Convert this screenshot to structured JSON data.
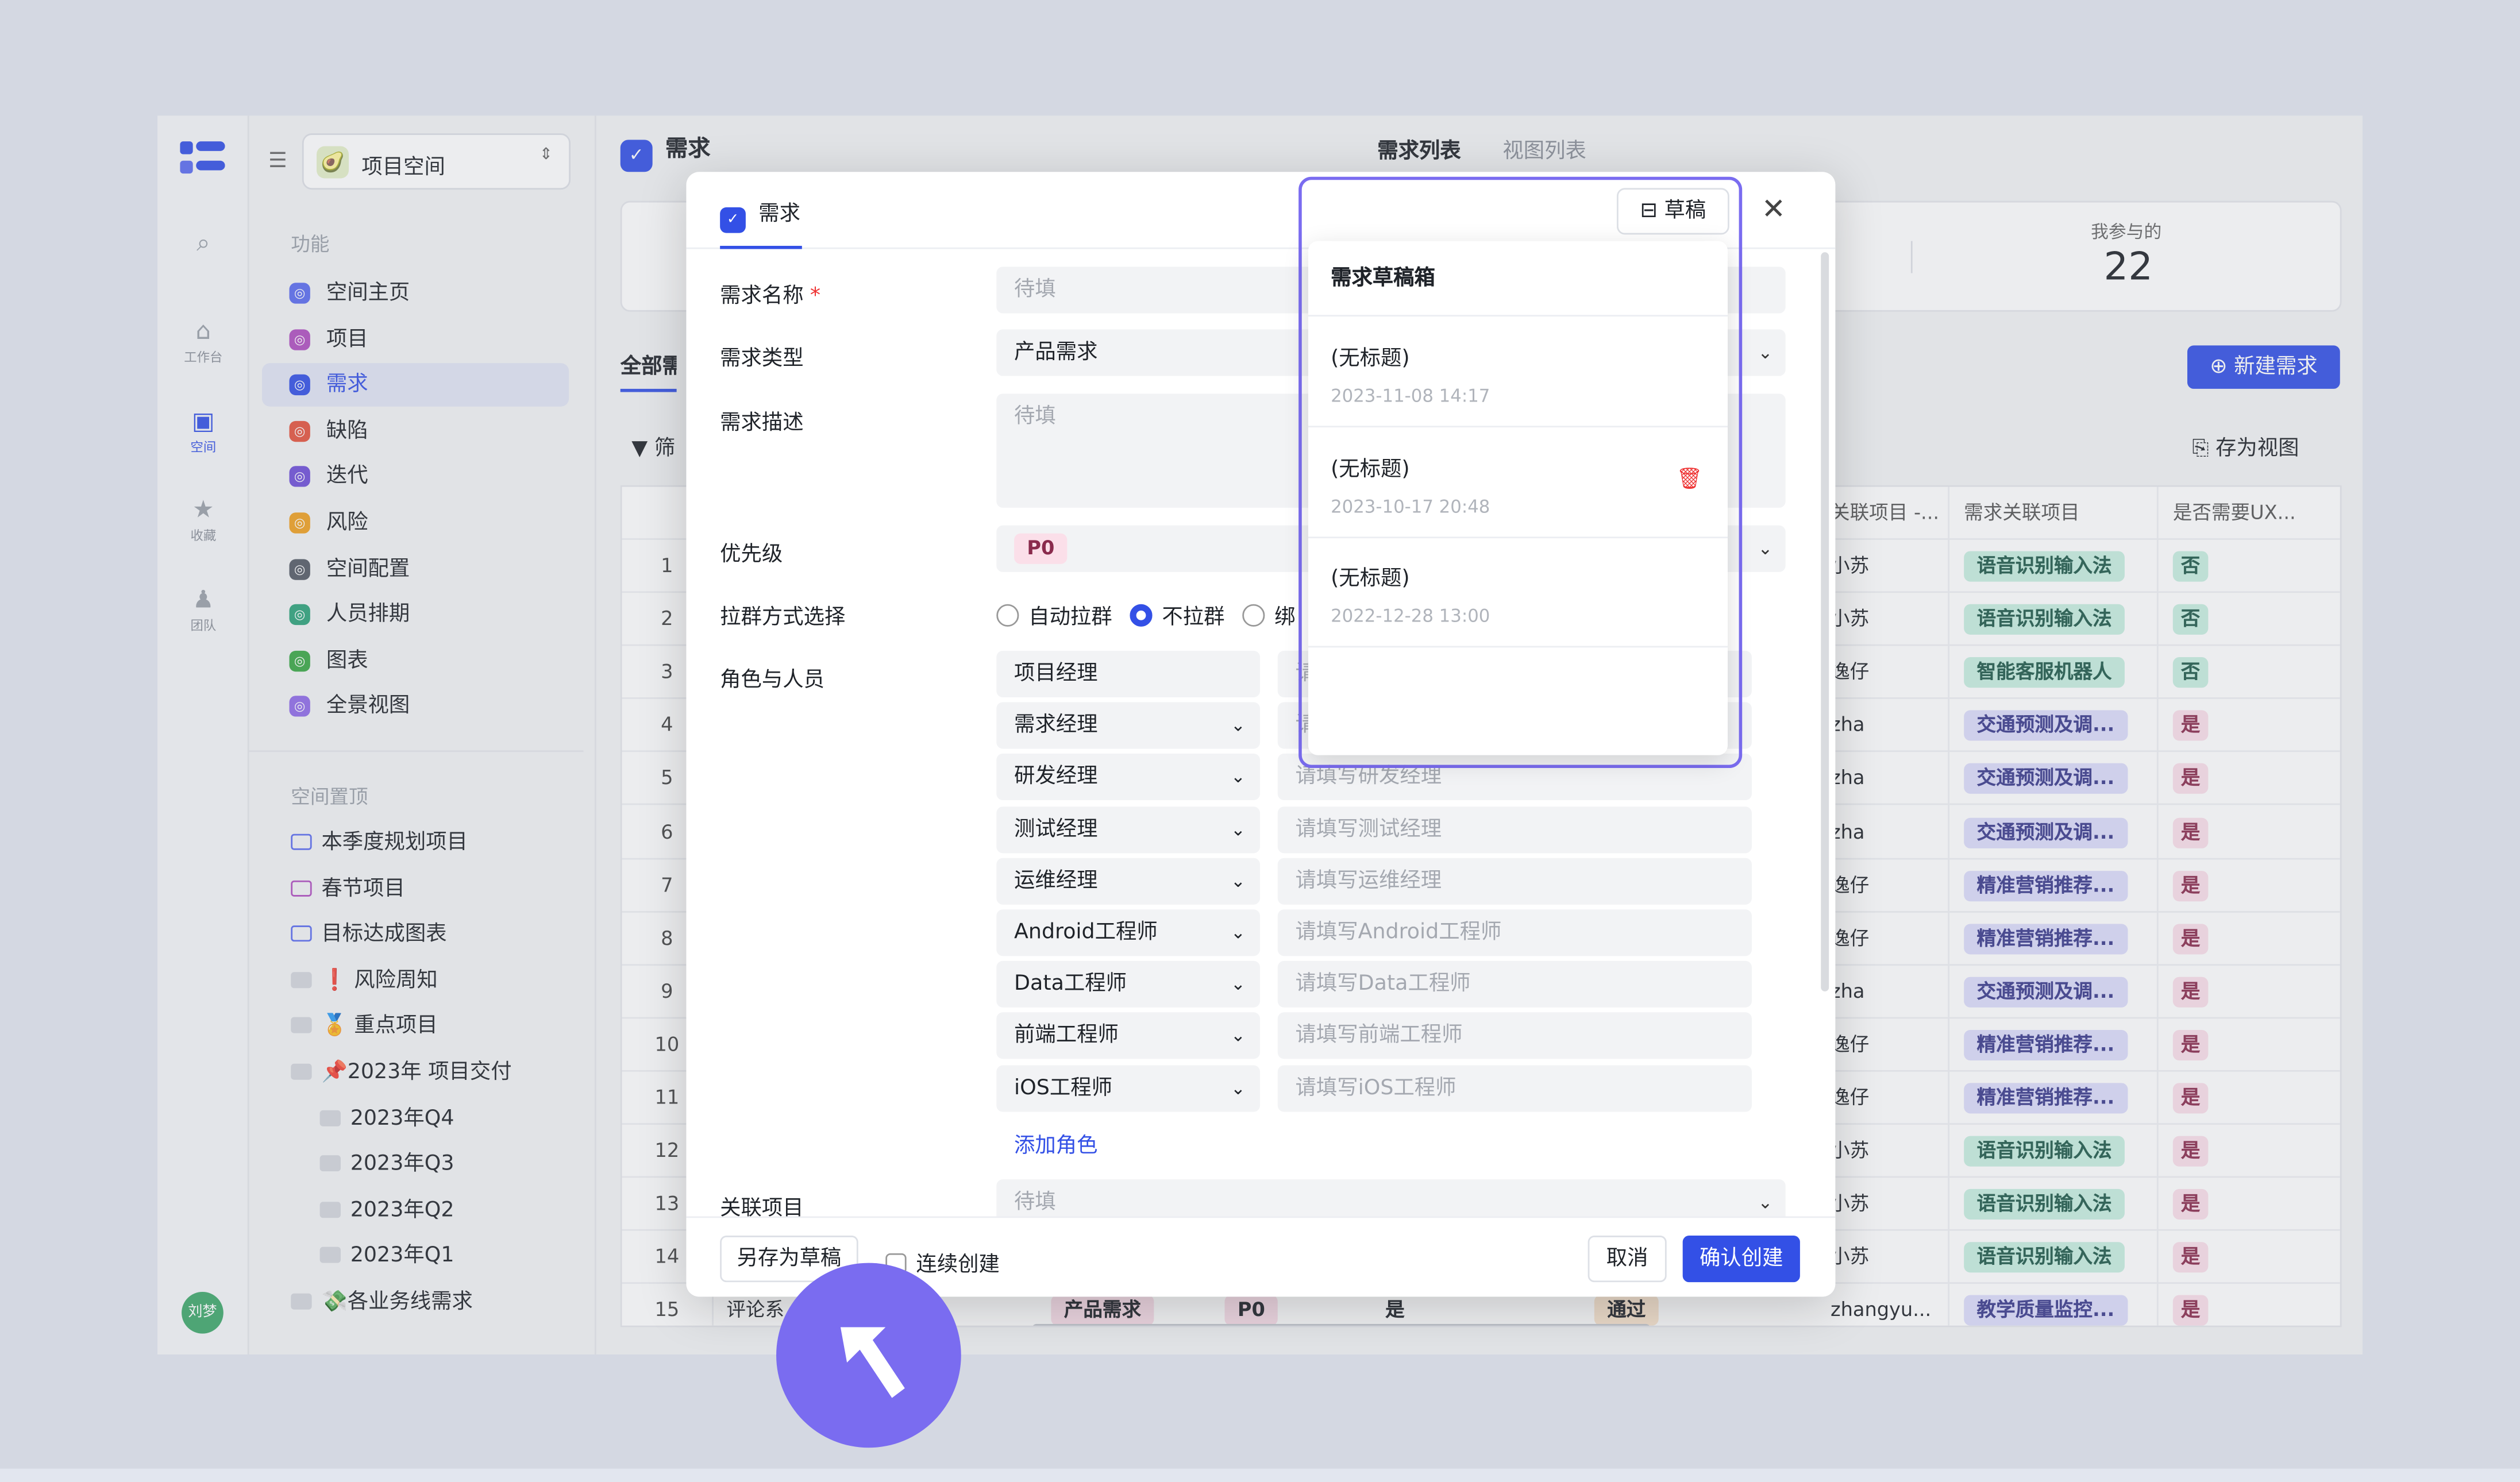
{
  "rail": {
    "items": [
      {
        "label": "工作台"
      },
      {
        "label": "空间"
      },
      {
        "label": "收藏"
      },
      {
        "label": "团队"
      }
    ],
    "avatar": "刘梦"
  },
  "sidebar": {
    "space": "项目空间",
    "section1": "功能",
    "items": [
      {
        "label": "空间主页",
        "color": "#5b6cf0"
      },
      {
        "label": "项目",
        "color": "#b04fc0"
      },
      {
        "label": "需求",
        "color": "#3350e6"
      },
      {
        "label": "缺陷",
        "color": "#e5533d"
      },
      {
        "label": "迭代",
        "color": "#6e4fd8"
      },
      {
        "label": "风险",
        "color": "#f0a020"
      },
      {
        "label": "空间配置",
        "color": "#555b66"
      },
      {
        "label": "人员排期",
        "color": "#2ea37a"
      },
      {
        "label": "图表",
        "color": "#3aa845"
      },
      {
        "label": "全景视图",
        "color": "#8f6be8"
      }
    ],
    "section2": "空间置顶",
    "pinned": [
      {
        "label": "本季度规划项目"
      },
      {
        "label": "春节项目"
      },
      {
        "label": "目标达成图表"
      },
      {
        "label": "❗ 风险周知"
      },
      {
        "label": "🏅 重点项目"
      },
      {
        "label": "📌2023年 项目交付"
      },
      {
        "label": "2023年Q4"
      },
      {
        "label": "2023年Q3"
      },
      {
        "label": "2023年Q2"
      },
      {
        "label": "2023年Q1"
      },
      {
        "label": "💸各业务线需求"
      }
    ]
  },
  "main": {
    "title": "需求",
    "tabs": [
      "需求列表",
      "视图列表"
    ],
    "stat_label": "我参与的",
    "stat_value": "22",
    "all_tab": "全部需求",
    "filter": "筛",
    "new_btn": "新建需求",
    "save_view": "存为视图",
    "columns": [
      "关联项目 -...",
      "需求关联项目",
      "是否需要UX..."
    ],
    "rows": [
      {
        "n": "1",
        "p": "小苏",
        "tag": "语音识别输入法",
        "tc": "a",
        "ux": "否"
      },
      {
        "n": "2",
        "p": "小苏",
        "tag": "语音识别输入法",
        "tc": "a",
        "ux": "否"
      },
      {
        "n": "3",
        "p": "逸仔",
        "tag": "智能客服机器人",
        "tc": "a",
        "ux": "否"
      },
      {
        "n": "4",
        "p": "zha",
        "tag": "交通预测及调...",
        "tc": "b",
        "ux": "是"
      },
      {
        "n": "5",
        "p": "zha",
        "tag": "交通预测及调...",
        "tc": "b",
        "ux": "是"
      },
      {
        "n": "6",
        "p": "zha",
        "tag": "交通预测及调...",
        "tc": "b",
        "ux": "是"
      },
      {
        "n": "7",
        "p": "逸仔",
        "tag": "精准营销推荐...",
        "tc": "b",
        "ux": "是"
      },
      {
        "n": "8",
        "p": "逸仔",
        "tag": "精准营销推荐...",
        "tc": "b",
        "ux": "是"
      },
      {
        "n": "9",
        "p": "zha",
        "tag": "交通预测及调...",
        "tc": "b",
        "ux": "是"
      },
      {
        "n": "10",
        "p": "逸仔",
        "tag": "精准营销推荐...",
        "tc": "b",
        "ux": "是"
      },
      {
        "n": "11",
        "p": "逸仔",
        "tag": "精准营销推荐...",
        "tc": "b",
        "ux": "是"
      },
      {
        "n": "12",
        "p": "小苏",
        "tag": "语音识别输入法",
        "tc": "a",
        "ux": "是"
      },
      {
        "n": "13",
        "p": "小苏",
        "tag": "语音识别输入法",
        "tc": "a",
        "ux": "是"
      },
      {
        "n": "14",
        "p": "小苏",
        "tag": "语音识别输入法",
        "tc": "a",
        "ux": "是"
      },
      {
        "n": "15",
        "p": "zhangyu...",
        "tag": "教学质量监控...",
        "tc": "b",
        "ux": "是"
      }
    ],
    "row15": {
      "name": "评论系",
      "type": "产品需求",
      "pri": "P0",
      "yes": "是",
      "status": "通过"
    }
  },
  "modal": {
    "tab": "需求",
    "fields": {
      "name_label": "需求名称",
      "name_ph": "待填",
      "type_label": "需求类型",
      "type_val": "产品需求",
      "desc_label": "需求描述",
      "desc_ph": "待填",
      "pri_label": "优先级",
      "pri_val": "P0",
      "group_label": "拉群方式选择",
      "radios": [
        "自动拉群",
        "不拉群",
        "绑"
      ],
      "roles_label": "角色与人员",
      "link_label": "关联项目",
      "link_ph": "待填"
    },
    "roles": [
      {
        "r": "项目经理",
        "ph": "请"
      },
      {
        "r": "需求经理",
        "ph": "请"
      },
      {
        "r": "研发经理",
        "ph": "请填写研发经理"
      },
      {
        "r": "测试经理",
        "ph": "请填写测试经理"
      },
      {
        "r": "运维经理",
        "ph": "请填写运维经理"
      },
      {
        "r": "Android工程师",
        "ph": "请填写Android工程师"
      },
      {
        "r": "Data工程师",
        "ph": "请填写Data工程师"
      },
      {
        "r": "前端工程师",
        "ph": "请填写前端工程师"
      },
      {
        "r": "iOS工程师",
        "ph": "请填写iOS工程师"
      }
    ],
    "add_role": "添加角色",
    "save_draft": "另存为草稿",
    "continuous": "连续创建",
    "cancel": "取消",
    "confirm": "确认创建",
    "draft_btn": "草稿",
    "drafts": {
      "title": "需求草稿箱",
      "items": [
        {
          "t": "(无标题)",
          "d": "2023-11-08 14:17"
        },
        {
          "t": "(无标题)",
          "d": "2023-10-17 20:48"
        },
        {
          "t": "(无标题)",
          "d": "2022-12-28 13:00"
        }
      ]
    }
  }
}
